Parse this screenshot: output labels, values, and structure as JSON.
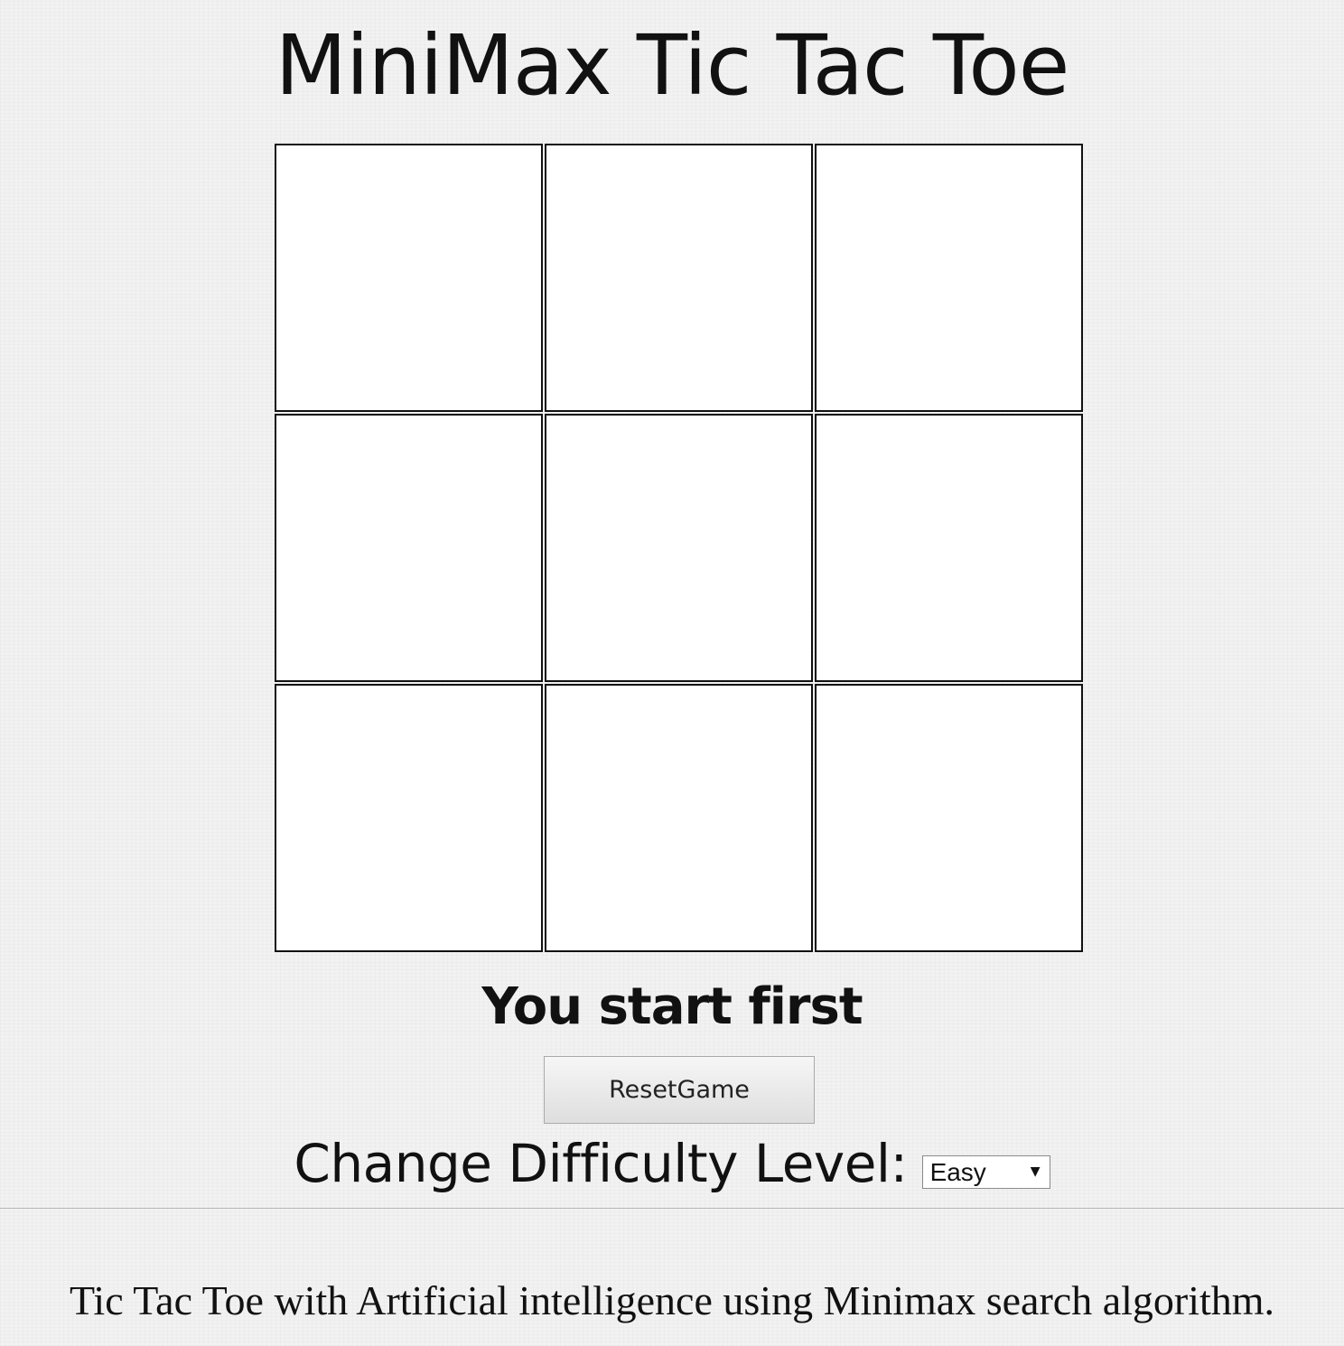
{
  "header": {
    "title": "MiniMax Tic Tac Toe"
  },
  "board": {
    "cells": [
      "",
      "",
      "",
      "",
      "",
      "",
      "",
      "",
      ""
    ]
  },
  "status": {
    "message": "You start first"
  },
  "controls": {
    "reset_label": "ResetGame",
    "difficulty_label": "Change Difficulty Level:",
    "difficulty_selected": "Easy"
  },
  "footer": {
    "description": "Tic Tac Toe with Artificial intelligence using Minimax search algorithm."
  },
  "colors": {
    "background": "#f2f2f2",
    "cell_background": "#ffffff",
    "cell_border": "#111111"
  }
}
